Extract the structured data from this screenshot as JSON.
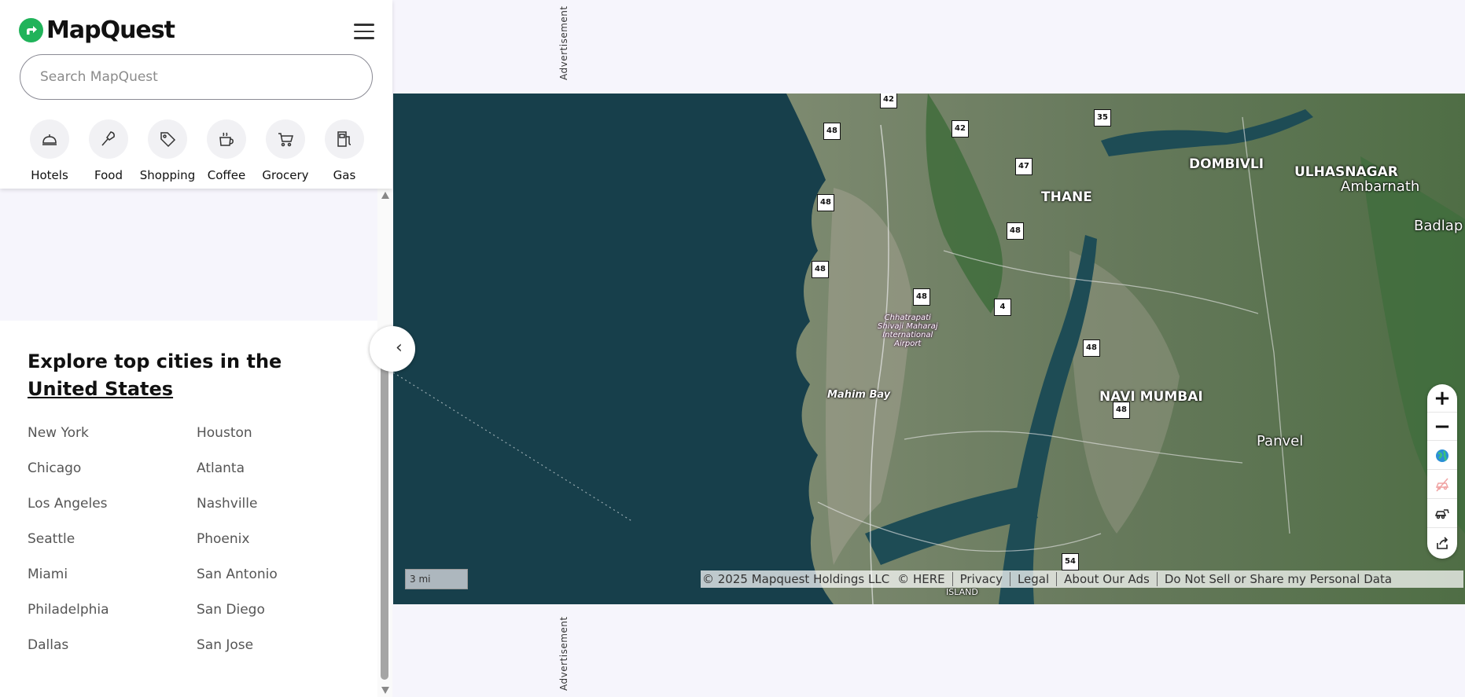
{
  "brand": {
    "name": "MapQuest",
    "logo_color": "#20b35a"
  },
  "search": {
    "placeholder": "Search MapQuest"
  },
  "categories": [
    {
      "label": "Hotels",
      "icon": "hotel-bell-icon"
    },
    {
      "label": "Food",
      "icon": "utensils-icon"
    },
    {
      "label": "Shopping",
      "icon": "tag-icon"
    },
    {
      "label": "Coffee",
      "icon": "coffee-cup-icon"
    },
    {
      "label": "Grocery",
      "icon": "cart-icon"
    },
    {
      "label": "Gas",
      "icon": "gas-pump-icon"
    }
  ],
  "explore": {
    "title_prefix": "Explore top cities in the",
    "country_link": "United States",
    "cities_left": [
      "New York",
      "Chicago",
      "Los Angeles",
      "Seattle",
      "Miami",
      "Philadelphia",
      "Dallas"
    ],
    "cities_right": [
      "Houston",
      "Atlanta",
      "Nashville",
      "Phoenix",
      "San Antonio",
      "San Diego",
      "San Jose"
    ]
  },
  "ads": {
    "label": "Advertisement"
  },
  "map": {
    "places": {
      "ulhasnagar": "ULHASNAGAR",
      "dombivli": "DOMBIVLI",
      "thane": "THANE",
      "ambarnath": "Ambarnath",
      "badlapur": "Badlap",
      "navi_mumbai": "NAVI MUMBAI",
      "panvel": "Panvel",
      "mahim_bay": "Mahim Bay",
      "island": "ISLAND",
      "airport": [
        "Chhatrapati",
        "Shivaji Maharaj",
        "International",
        "Airport"
      ]
    },
    "shields": [
      "42",
      "48",
      "42",
      "35",
      "47",
      "48",
      "48",
      "48",
      "48",
      "4",
      "48",
      "48",
      "54"
    ],
    "scale": "3 mi",
    "controls": {
      "zoom_in": "+",
      "zoom_out": "−",
      "icons": [
        "globe-icon",
        "traffic-off-icon",
        "car-traffic-icon",
        "share-icon"
      ]
    },
    "attribution": {
      "copyright": "© 2025 Mapquest Holdings LLC",
      "here": "© HERE",
      "links": [
        "Privacy",
        "Legal",
        "About Our Ads",
        "Do Not Sell or Share my Personal Data"
      ]
    },
    "colors": {
      "sea": "#173f4b",
      "land": "#6b7a5c",
      "forest": "#3d6b3a"
    }
  }
}
